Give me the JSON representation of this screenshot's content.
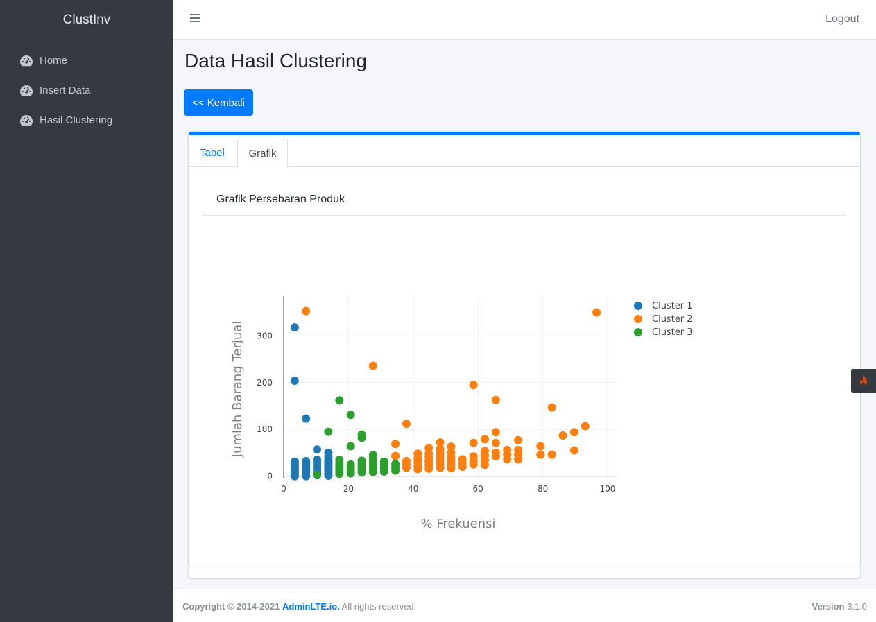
{
  "app": {
    "brand": "ClustInv"
  },
  "sidebar": {
    "items": [
      {
        "label": "Home",
        "icon": "tachometer-icon"
      },
      {
        "label": "Insert Data",
        "icon": "tachometer-icon"
      },
      {
        "label": "Hasil Clustering",
        "icon": "tachometer-icon"
      }
    ]
  },
  "topbar": {
    "logout": "Logout"
  },
  "page": {
    "title": "Data Hasil Clustering",
    "back_button": "<< Kembali"
  },
  "tabs": [
    {
      "label": "Tabel",
      "active": false
    },
    {
      "label": "Grafik",
      "active": true
    }
  ],
  "chart_section": {
    "title": "Grafik Persebaran Produk"
  },
  "footer": {
    "copyright": "Copyright © 2014-2021",
    "link": "AdminLTE.io.",
    "rights": "All rights reserved.",
    "version_label": "Version",
    "version": "3.1.0"
  },
  "colors": {
    "accent": "#007bff",
    "sidebar_bg": "#343a40",
    "cluster1": "#1f77b4",
    "cluster2": "#ff7f0e",
    "cluster3": "#2ca02c"
  },
  "chart_data": {
    "type": "scatter",
    "title": "",
    "xlabel": "% Frekuensi",
    "ylabel": "Jumlah Barang Terjual",
    "xlim": [
      0,
      103
    ],
    "ylim": [
      -5,
      385
    ],
    "xticks": [
      0,
      20,
      40,
      60,
      80,
      100
    ],
    "yticks": [
      0,
      100,
      200,
      300
    ],
    "grid": true,
    "legend": "top-right",
    "series": [
      {
        "name": "Cluster 1",
        "color": "#1f77b4",
        "points": [
          [
            3.4,
            0
          ],
          [
            3.4,
            3
          ],
          [
            3.4,
            6
          ],
          [
            3.4,
            10
          ],
          [
            3.4,
            14
          ],
          [
            3.4,
            18
          ],
          [
            3.4,
            22
          ],
          [
            3.4,
            26
          ],
          [
            3.4,
            31
          ],
          [
            3.4,
            204
          ],
          [
            3.4,
            318
          ],
          [
            6.9,
            0
          ],
          [
            6.9,
            4
          ],
          [
            6.9,
            8
          ],
          [
            6.9,
            12
          ],
          [
            6.9,
            16
          ],
          [
            6.9,
            20
          ],
          [
            6.9,
            24
          ],
          [
            6.9,
            28
          ],
          [
            6.9,
            32
          ],
          [
            6.9,
            123
          ],
          [
            10.3,
            2
          ],
          [
            10.3,
            6
          ],
          [
            10.3,
            10
          ],
          [
            10.3,
            15
          ],
          [
            10.3,
            20
          ],
          [
            10.3,
            25
          ],
          [
            10.3,
            30
          ],
          [
            10.3,
            35
          ],
          [
            10.3,
            57
          ],
          [
            13.8,
            1
          ],
          [
            13.8,
            6
          ],
          [
            13.8,
            11
          ],
          [
            13.8,
            16
          ],
          [
            13.8,
            21
          ],
          [
            13.8,
            26
          ],
          [
            13.8,
            31
          ],
          [
            13.8,
            36
          ],
          [
            13.8,
            42
          ],
          [
            13.8,
            50
          ]
        ]
      },
      {
        "name": "Cluster 2",
        "color": "#ff7f0e",
        "points": [
          [
            6.9,
            353
          ],
          [
            27.6,
            236
          ],
          [
            34.5,
            43
          ],
          [
            34.5,
            69
          ],
          [
            37.9,
            18
          ],
          [
            37.9,
            25
          ],
          [
            37.9,
            32
          ],
          [
            37.9,
            112
          ],
          [
            41.4,
            15
          ],
          [
            41.4,
            22
          ],
          [
            41.4,
            30
          ],
          [
            41.4,
            38
          ],
          [
            41.4,
            48
          ],
          [
            44.8,
            16
          ],
          [
            44.8,
            24
          ],
          [
            44.8,
            32
          ],
          [
            44.8,
            40
          ],
          [
            44.8,
            48
          ],
          [
            44.8,
            60
          ],
          [
            48.3,
            18
          ],
          [
            48.3,
            26
          ],
          [
            48.3,
            34
          ],
          [
            48.3,
            42
          ],
          [
            48.3,
            50
          ],
          [
            48.3,
            58
          ],
          [
            48.3,
            72
          ],
          [
            51.7,
            17
          ],
          [
            51.7,
            25
          ],
          [
            51.7,
            33
          ],
          [
            51.7,
            41
          ],
          [
            51.7,
            50
          ],
          [
            51.7,
            63
          ],
          [
            55.2,
            20
          ],
          [
            55.2,
            28
          ],
          [
            55.2,
            36
          ],
          [
            58.6,
            25
          ],
          [
            58.6,
            33
          ],
          [
            58.6,
            42
          ],
          [
            58.6,
            71
          ],
          [
            58.6,
            195
          ],
          [
            62.1,
            24
          ],
          [
            62.1,
            34
          ],
          [
            62.1,
            44
          ],
          [
            62.1,
            54
          ],
          [
            62.1,
            79
          ],
          [
            65.5,
            42
          ],
          [
            65.5,
            50
          ],
          [
            65.5,
            71
          ],
          [
            65.5,
            94
          ],
          [
            65.5,
            163
          ],
          [
            69.0,
            36
          ],
          [
            69.0,
            46
          ],
          [
            69.0,
            56
          ],
          [
            72.4,
            36
          ],
          [
            72.4,
            46
          ],
          [
            72.4,
            56
          ],
          [
            72.4,
            77
          ],
          [
            79.3,
            46
          ],
          [
            79.3,
            64
          ],
          [
            82.8,
            46
          ],
          [
            82.8,
            147
          ],
          [
            86.2,
            87
          ],
          [
            89.7,
            55
          ],
          [
            89.7,
            94
          ],
          [
            93.1,
            107
          ],
          [
            96.6,
            350
          ]
        ]
      },
      {
        "name": "Cluster 3",
        "color": "#2ca02c",
        "points": [
          [
            10.3,
            3
          ],
          [
            13.8,
            95
          ],
          [
            17.2,
            5
          ],
          [
            17.2,
            10
          ],
          [
            17.2,
            16
          ],
          [
            17.2,
            22
          ],
          [
            17.2,
            28
          ],
          [
            17.2,
            35
          ],
          [
            17.2,
            162
          ],
          [
            20.7,
            6
          ],
          [
            20.7,
            12
          ],
          [
            20.7,
            18
          ],
          [
            20.7,
            25
          ],
          [
            20.7,
            64
          ],
          [
            20.7,
            131
          ],
          [
            24.1,
            8
          ],
          [
            24.1,
            14
          ],
          [
            24.1,
            20
          ],
          [
            24.1,
            27
          ],
          [
            24.1,
            33
          ],
          [
            24.1,
            82
          ],
          [
            24.1,
            89
          ],
          [
            27.6,
            9
          ],
          [
            27.6,
            16
          ],
          [
            27.6,
            23
          ],
          [
            27.6,
            30
          ],
          [
            27.6,
            37
          ],
          [
            27.6,
            45
          ],
          [
            31.0,
            10
          ],
          [
            31.0,
            17
          ],
          [
            31.0,
            24
          ],
          [
            31.0,
            31
          ],
          [
            34.5,
            12
          ],
          [
            34.5,
            19
          ],
          [
            34.5,
            26
          ]
        ]
      }
    ]
  }
}
